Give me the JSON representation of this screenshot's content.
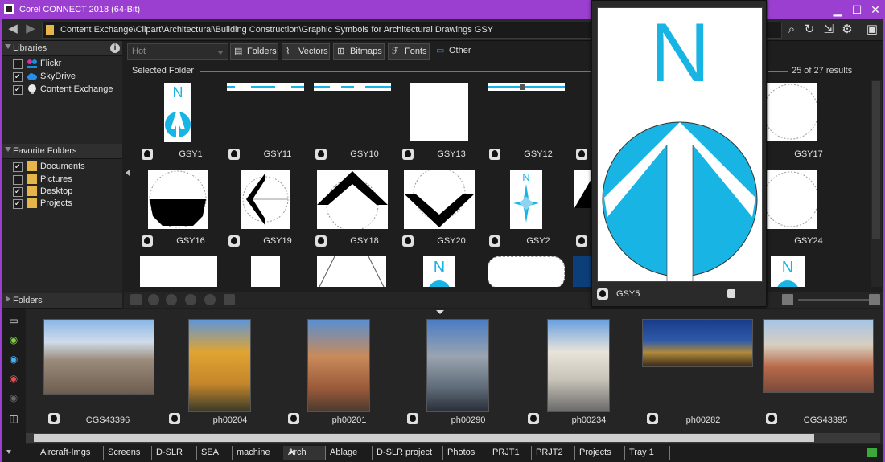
{
  "window": {
    "title": "Corel CONNECT 2018 (64-Bit)",
    "minimize": "▁",
    "maximize": "☐",
    "close": "✕"
  },
  "toolbar": {
    "path": "Content Exchange\\Clipart\\Architectural\\Building Construction\\Graphic Symbols for Architectural Drawings GSY",
    "icons": [
      "back-icon",
      "forward-icon",
      "search-icon",
      "refresh-icon",
      "export-icon",
      "gear-icon",
      "panel-icon"
    ]
  },
  "sidebar": {
    "libraries_header": "Libraries",
    "libraries": [
      {
        "label": "Flickr",
        "checked": false,
        "icon": "flickr-icon"
      },
      {
        "label": "SkyDrive",
        "checked": true,
        "icon": "cloud-icon"
      },
      {
        "label": "Content Exchange",
        "checked": true,
        "icon": "bulb-icon"
      }
    ],
    "favorites_header": "Favorite Folders",
    "favorites": [
      {
        "label": "Documents",
        "checked": true
      },
      {
        "label": "Pictures",
        "checked": false
      },
      {
        "label": "Desktop",
        "checked": true
      },
      {
        "label": "Projects",
        "checked": true
      }
    ],
    "folders_header": "Folders"
  },
  "filter": {
    "sort_value": "Hot",
    "buttons": [
      {
        "label": "Folders",
        "icon": "folder-icon"
      },
      {
        "label": "Vectors",
        "icon": "vector-icon"
      },
      {
        "label": "Bitmaps",
        "icon": "bitmap-icon"
      },
      {
        "label": "Fonts",
        "icon": "font-icon"
      },
      {
        "label": "Other",
        "icon": "document-icon"
      }
    ]
  },
  "content": {
    "section_title": "Selected Folder",
    "results": "25 of 27 results",
    "row1": [
      "GSY1",
      "GSY11",
      "GSY10",
      "GSY13",
      "GSY12",
      "",
      "",
      "GSY17"
    ],
    "row2": [
      "GSY16",
      "GSY19",
      "GSY18",
      "GSY20",
      "GSY2",
      "",
      "",
      "GSY24"
    ]
  },
  "preview": {
    "label": "GSY5",
    "letter": "N"
  },
  "tray": {
    "items": [
      {
        "label": "CGS43396"
      },
      {
        "label": "ph00204"
      },
      {
        "label": "ph00201"
      },
      {
        "label": "ph00290"
      },
      {
        "label": "ph00234"
      },
      {
        "label": "ph00282"
      },
      {
        "label": "CGS43395"
      }
    ]
  },
  "tabs": [
    "Aircraft-Imgs",
    "Screens",
    "D-SLR",
    "SEA",
    "machine",
    "Arch",
    "Ablage",
    "D-SLR project",
    "Photos",
    "PRJT1",
    "PRJT2",
    "Projects",
    "Tray 1"
  ]
}
